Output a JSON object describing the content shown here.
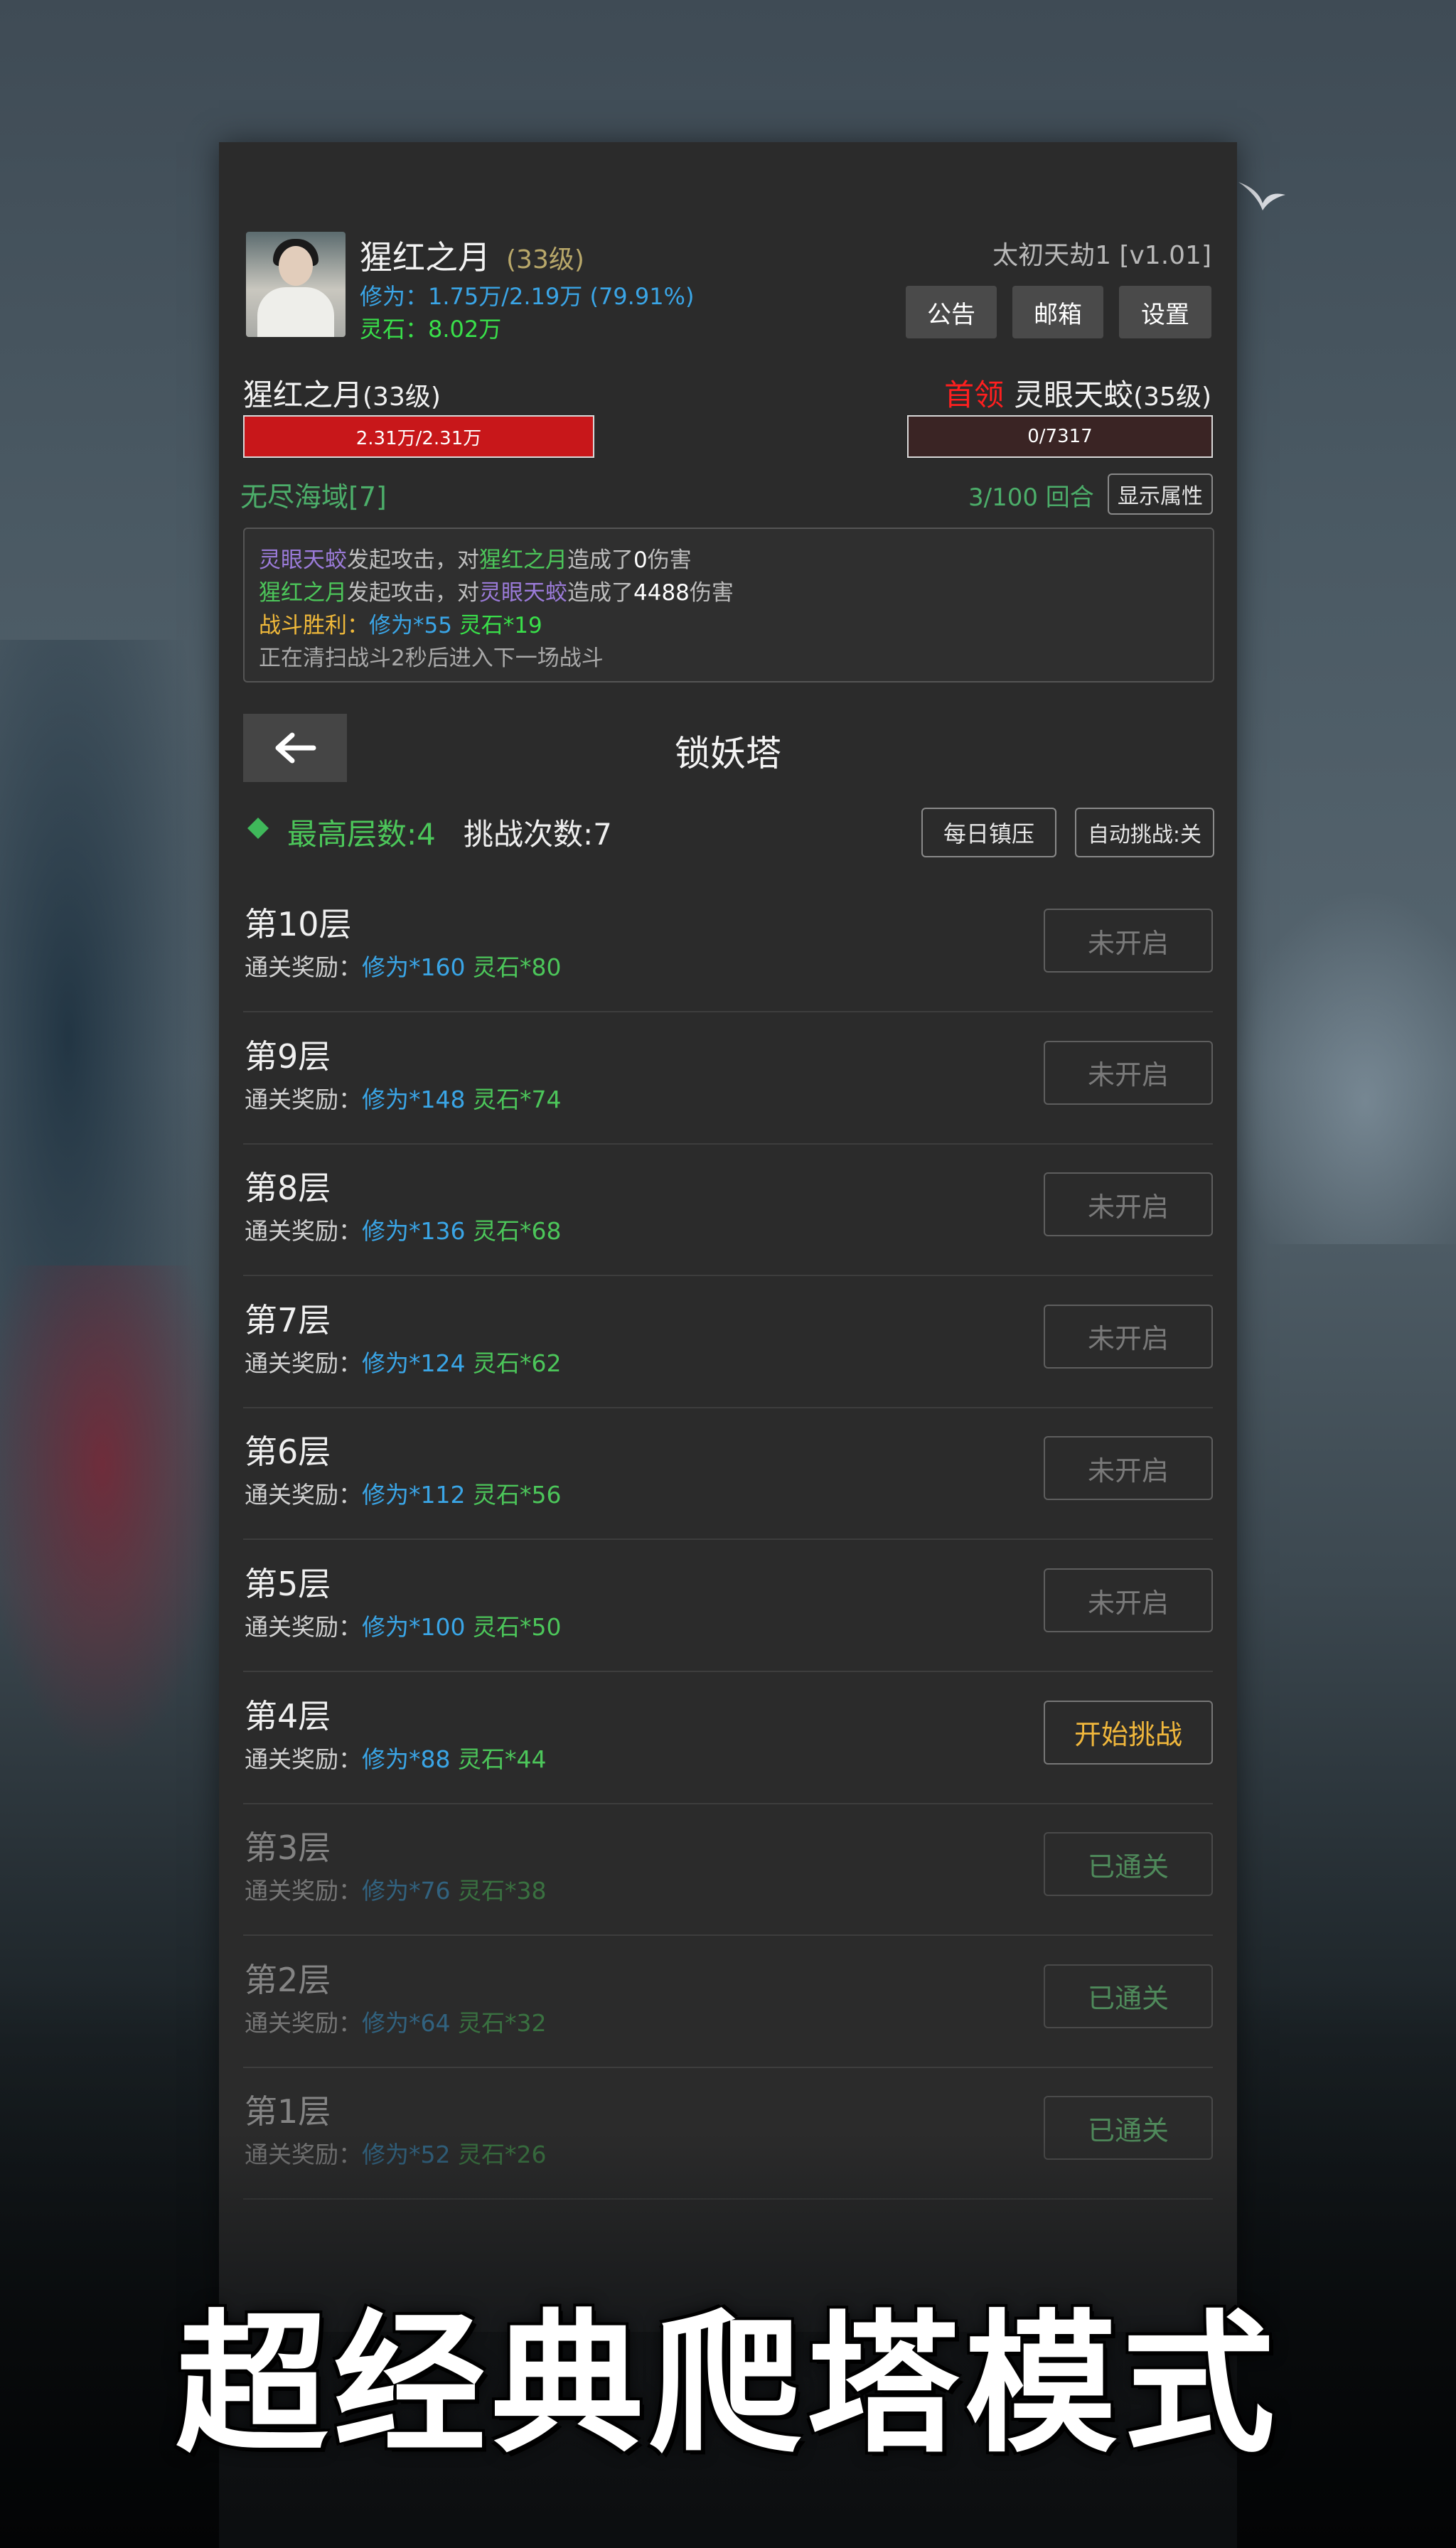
{
  "header": {
    "player_name": "猩红之月",
    "player_level": "(33级)",
    "cultivation": "修为：1.75万/2.19万 (79.91%)",
    "spirit_stone": "灵石：8.02万",
    "game_title": "太初天劫1 [v1.01]",
    "buttons": {
      "notice": "公告",
      "mail": "邮箱",
      "settings": "设置"
    }
  },
  "battle": {
    "player_label": "猩红之月",
    "player_level": "(33级)",
    "player_hp": "2.31万/2.31万",
    "boss_tag": "首领",
    "enemy_name": "灵眼天蛟",
    "enemy_level": "(35级)",
    "enemy_hp": "0/7317",
    "region": "无尽海域[7]",
    "round": "3/100 回合",
    "show_attr": "显示属性"
  },
  "log": {
    "line1": {
      "actor": "灵眼天蛟",
      "mid": "发起攻击，对",
      "target": "猩红之月",
      "mid2": "造成了",
      "dmg": "0",
      "end": "伤害"
    },
    "line2": {
      "actor": "猩红之月",
      "mid": "发起攻击，对",
      "target": "灵眼天蛟",
      "mid2": "造成了",
      "dmg": "4488",
      "end": "伤害"
    },
    "line3": {
      "label": "战斗胜利：",
      "xp": "修为*55",
      "stone": "灵石*19"
    },
    "line4": "正在清扫战斗2秒后进入下一场战斗"
  },
  "tower": {
    "title": "锁妖塔",
    "max_floor": "最高层数:4",
    "challenges": "挑战次数:7",
    "daily_btn": "每日镇压",
    "auto_btn": "自动挑战:关",
    "reward_label": "通关奖励：",
    "floors": [
      {
        "name": "第10层",
        "xp": "修为*160",
        "stone": "灵石*80",
        "status": "未开启"
      },
      {
        "name": "第9层",
        "xp": "修为*148",
        "stone": "灵石*74",
        "status": "未开启"
      },
      {
        "name": "第8层",
        "xp": "修为*136",
        "stone": "灵石*68",
        "status": "未开启"
      },
      {
        "name": "第7层",
        "xp": "修为*124",
        "stone": "灵石*62",
        "status": "未开启"
      },
      {
        "name": "第6层",
        "xp": "修为*112",
        "stone": "灵石*56",
        "status": "未开启"
      },
      {
        "name": "第5层",
        "xp": "修为*100",
        "stone": "灵石*50",
        "status": "未开启"
      },
      {
        "name": "第4层",
        "xp": "修为*88",
        "stone": "灵石*44",
        "status": "开始挑战"
      },
      {
        "name": "第3层",
        "xp": "修为*76",
        "stone": "灵石*38",
        "status": "已通关"
      },
      {
        "name": "第2层",
        "xp": "修为*64",
        "stone": "灵石*32",
        "status": "已通关"
      },
      {
        "name": "第1层",
        "xp": "修为*52",
        "stone": "灵石*26",
        "status": "已通关"
      }
    ]
  },
  "banner": "超经典爬塔模式",
  "colors": {
    "hp_red": "#c8171a",
    "enemy_bar": "#3a2424",
    "region_green": "#4cae6a",
    "current_gold": "#f0b73c",
    "cleared_green": "#4f8a5b"
  }
}
